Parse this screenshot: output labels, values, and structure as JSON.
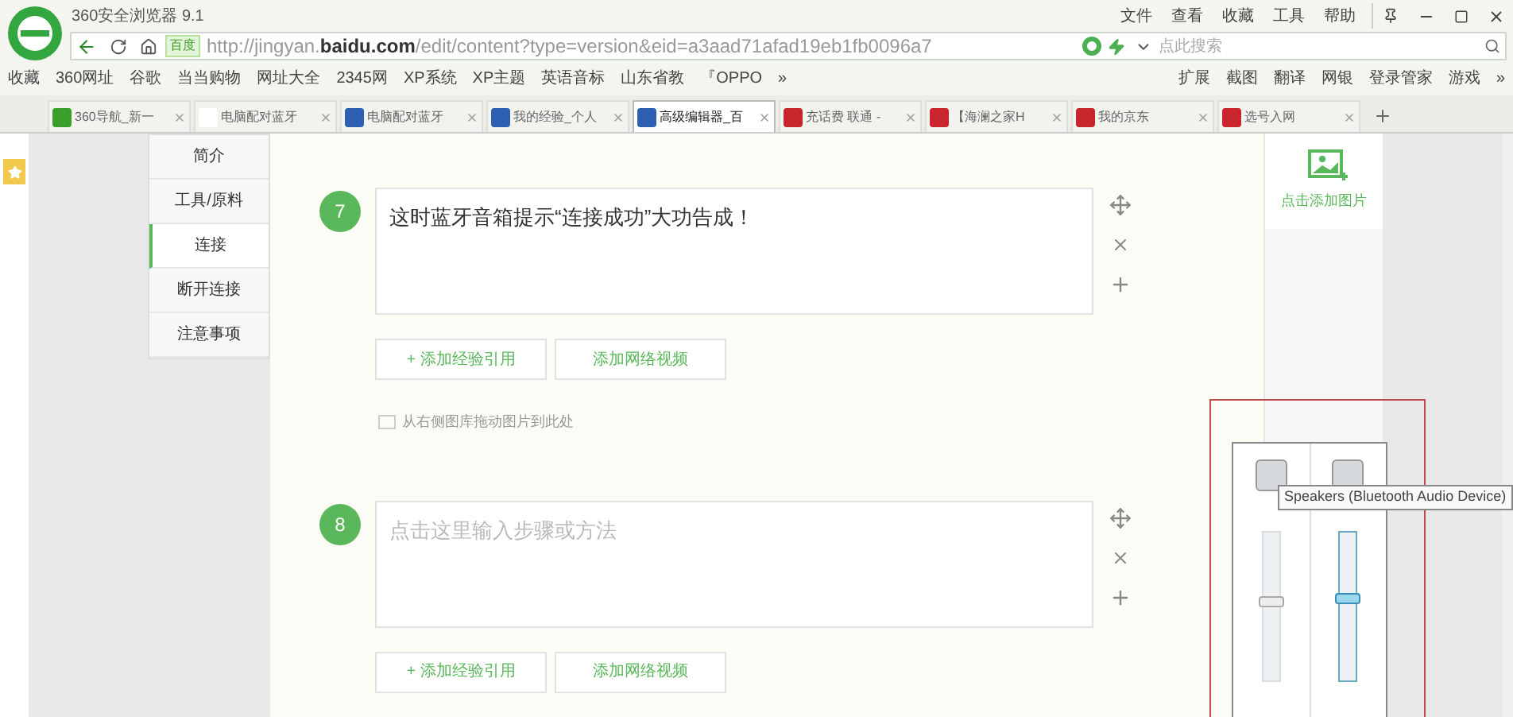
{
  "window": {
    "title": "360安全浏览器 9.1",
    "menu": [
      "文件",
      "查看",
      "收藏",
      "工具",
      "帮助"
    ]
  },
  "address_bar": {
    "badge": "百度",
    "url_prefix": "http://jingyan.",
    "url_domain": "baidu.com",
    "url_path": "/edit/content?type=version&eid=a3aad71afad19eb1fb0096a7",
    "search_placeholder": "点此搜索"
  },
  "bookmarks": {
    "left": [
      "收藏",
      "360网址",
      "谷歌",
      "当当购物",
      "网址大全",
      "2345网",
      "XP系统",
      "XP主题",
      "英语音标",
      "山东省教",
      "『OPPO",
      "»"
    ],
    "right": [
      "扩展",
      "截图",
      "翻译",
      "网银",
      "登录管家",
      "游戏",
      "»"
    ]
  },
  "tabs": [
    {
      "label": "360导航_新一",
      "selected": false
    },
    {
      "label": "电脑配对蓝牙",
      "selected": false
    },
    {
      "label": "电脑配对蓝牙",
      "selected": false
    },
    {
      "label": "我的经验_个人",
      "selected": false
    },
    {
      "label": "高级编辑器_百",
      "selected": true
    },
    {
      "label": "充话费 联通 -",
      "selected": false
    },
    {
      "label": "【海澜之家H",
      "selected": false
    },
    {
      "label": "我的京东",
      "selected": false
    },
    {
      "label": "选号入网",
      "selected": false
    }
  ],
  "outline": [
    {
      "label": "简介",
      "selected": false
    },
    {
      "label": "工具/原料",
      "selected": false
    },
    {
      "label": "连接",
      "selected": true
    },
    {
      "label": "断开连接",
      "selected": false
    },
    {
      "label": "注意事项",
      "selected": false
    }
  ],
  "steps": [
    {
      "number": "7",
      "value": "这时蓝牙音箱提示“连接成功”大功告成！",
      "buttons": [
        "+ 添加经验引用",
        "添加网络视频"
      ],
      "drop_hint": "从右侧图库拖动图片到此处"
    },
    {
      "number": "8",
      "placeholder": "点击这里输入步骤或方法",
      "buttons": [
        "+ 添加经验引用",
        "添加网络视频"
      ]
    }
  ],
  "image_panel": {
    "label": "点击添加图片"
  },
  "volume_mixer": {
    "tooltip": "Speakers (Bluetooth Audio Device)",
    "channels": [
      {
        "level": 0.55,
        "active": false
      },
      {
        "level": 0.57,
        "active": true
      }
    ]
  }
}
